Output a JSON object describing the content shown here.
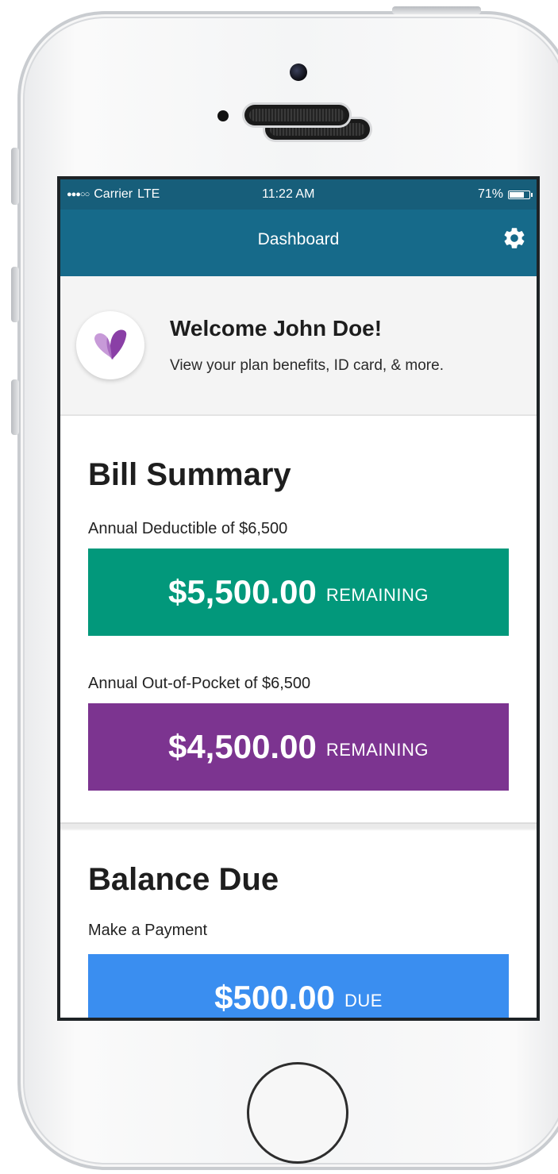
{
  "status_bar": {
    "signal": "●●●○○",
    "carrier": "Carrier",
    "network": "LTE",
    "time": "11:22 AM",
    "battery_percent": "71%",
    "battery_level": 0.71
  },
  "nav": {
    "title": "Dashboard",
    "settings_icon": "gear-icon"
  },
  "welcome": {
    "title": "Welcome John Doe!",
    "subtitle": "View your plan benefits, ID card, & more.",
    "logo_icon": "heart-logo-icon"
  },
  "bill_summary": {
    "title": "Bill Summary",
    "deductible": {
      "caption": "Annual Deductible of $6,500",
      "amount": "$5,500.00",
      "suffix": "REMAINING",
      "color": "#02987b"
    },
    "out_of_pocket": {
      "caption": "Annual Out-of-Pocket of $6,500",
      "amount": "$4,500.00",
      "suffix": "REMAINING",
      "color": "#7c3490"
    }
  },
  "balance_due": {
    "title": "Balance Due",
    "caption": "Make a Payment",
    "amount": "$500.00",
    "suffix": "DUE",
    "color": "#3a8ef0"
  },
  "theme": {
    "status_bar_color": "#175e7a",
    "nav_bar_color": "#166a8a"
  }
}
